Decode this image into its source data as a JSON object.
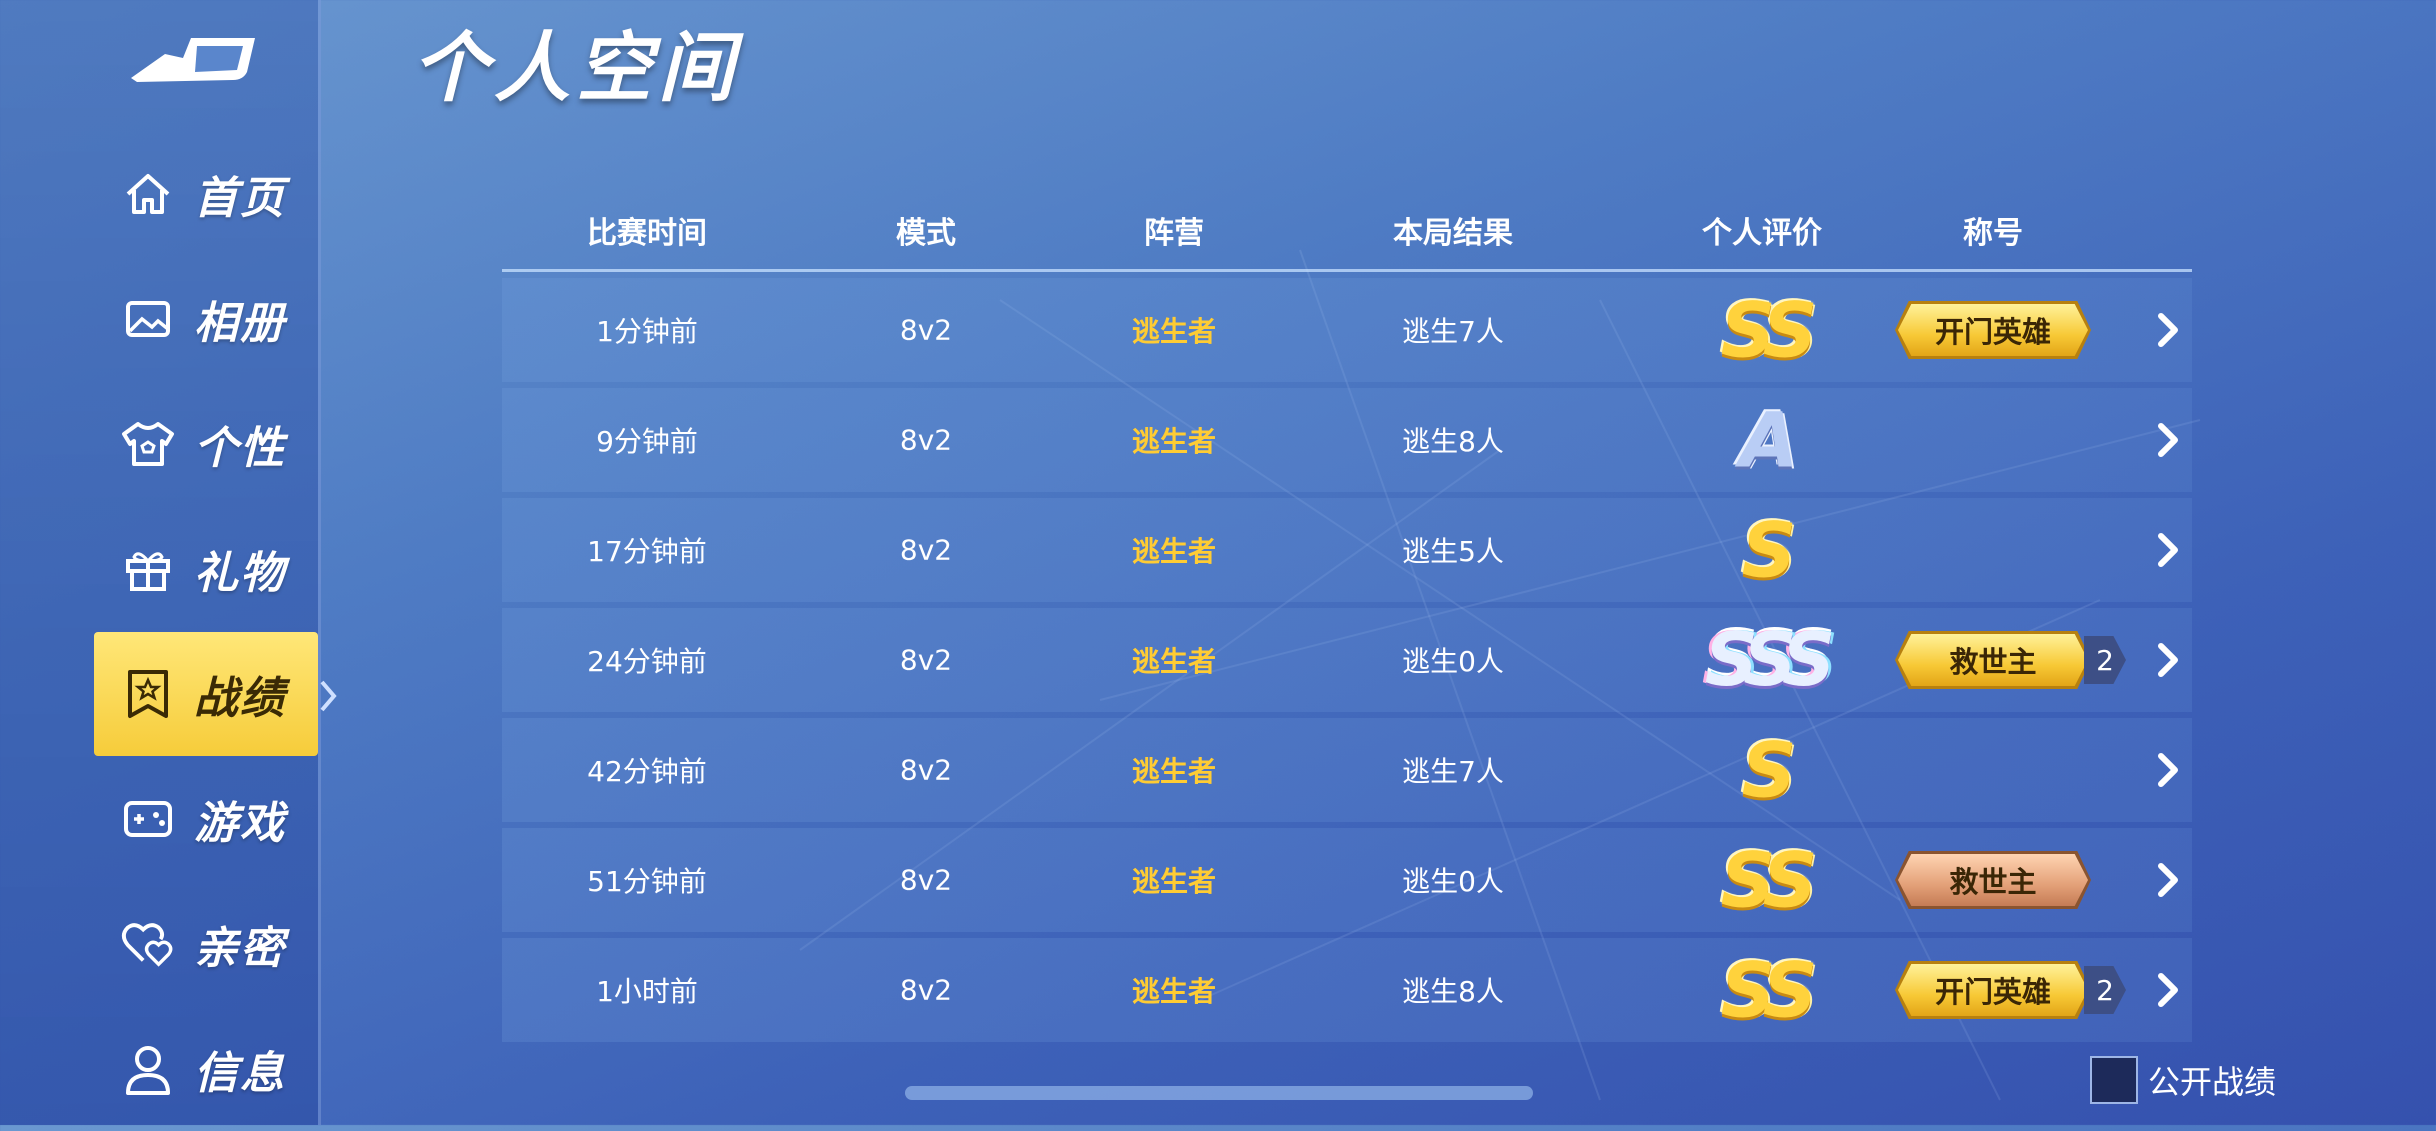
{
  "app": {
    "page_title": "个人空间"
  },
  "sidebar": {
    "items": [
      {
        "label": "首页",
        "icon": "home-icon"
      },
      {
        "label": "相册",
        "icon": "album-icon"
      },
      {
        "label": "个性",
        "icon": "shirt-icon"
      },
      {
        "label": "礼物",
        "icon": "gift-icon"
      },
      {
        "label": "战绩",
        "icon": "badge-icon",
        "active": true
      },
      {
        "label": "游戏",
        "icon": "gamepad-icon"
      },
      {
        "label": "亲密",
        "icon": "hearts-icon"
      },
      {
        "label": "信息",
        "icon": "user-icon"
      }
    ]
  },
  "table": {
    "headers": [
      "比赛时间",
      "模式",
      "阵营",
      "本局结果",
      "个人评价",
      "称号"
    ],
    "rows": [
      {
        "time": "1分钟前",
        "mode": "8v2",
        "camp": "逃生者",
        "result": "逃生7人",
        "grade": "SS",
        "grade_style": "gold",
        "title": "开门英雄",
        "title_style": "gold",
        "title_count": ""
      },
      {
        "time": "9分钟前",
        "mode": "8v2",
        "camp": "逃生者",
        "result": "逃生8人",
        "grade": "A",
        "grade_style": "blue",
        "title": "",
        "title_style": "",
        "title_count": ""
      },
      {
        "time": "17分钟前",
        "mode": "8v2",
        "camp": "逃生者",
        "result": "逃生5人",
        "grade": "S",
        "grade_style": "gold",
        "title": "",
        "title_style": "",
        "title_count": ""
      },
      {
        "time": "24分钟前",
        "mode": "8v2",
        "camp": "逃生者",
        "result": "逃生0人",
        "grade": "SSS",
        "grade_style": "rainbow",
        "title": "救世主",
        "title_style": "gold",
        "title_count": "2"
      },
      {
        "time": "42分钟前",
        "mode": "8v2",
        "camp": "逃生者",
        "result": "逃生7人",
        "grade": "S",
        "grade_style": "gold",
        "title": "",
        "title_style": "",
        "title_count": ""
      },
      {
        "time": "51分钟前",
        "mode": "8v2",
        "camp": "逃生者",
        "result": "逃生0人",
        "grade": "SS",
        "grade_style": "gold",
        "title": "救世主",
        "title_style": "bronze",
        "title_count": ""
      },
      {
        "time": "1小时前",
        "mode": "8v2",
        "camp": "逃生者",
        "result": "逃生8人",
        "grade": "SS",
        "grade_style": "gold",
        "title": "开门英雄",
        "title_style": "gold",
        "title_count": "2"
      }
    ]
  },
  "footer": {
    "public_label": "公开战绩",
    "public_checked": false
  },
  "colors": {
    "accent": "#f6cc3a",
    "camp": "#ffcc33",
    "background": "#4f7cc4"
  }
}
